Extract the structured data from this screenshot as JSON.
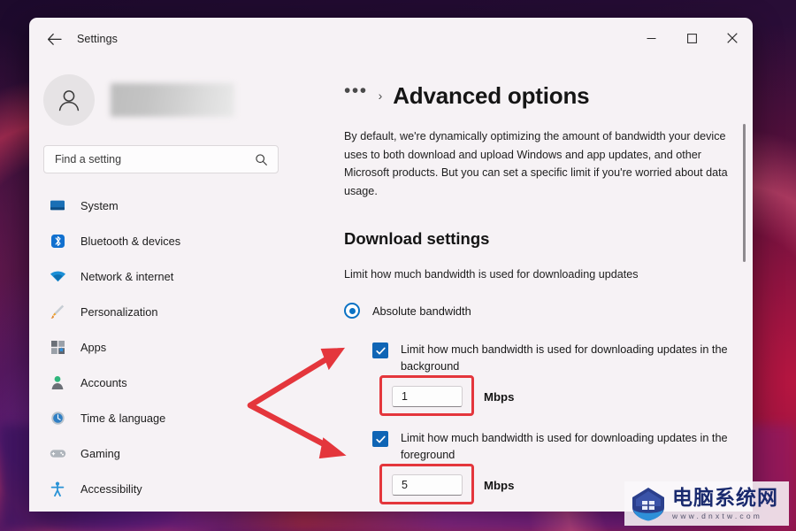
{
  "window": {
    "title": "Settings",
    "back_icon": "back-arrow-icon",
    "controls": {
      "minimize": "minimize-icon",
      "maximize": "maximize-icon",
      "close": "close-icon"
    }
  },
  "sidebar": {
    "account": {
      "name_redacted": "",
      "avatar_icon": "person-avatar-icon"
    },
    "search": {
      "placeholder": "Find a setting",
      "value": "",
      "icon": "search-icon"
    },
    "items": [
      {
        "label": "System",
        "icon": "monitor-icon"
      },
      {
        "label": "Bluetooth & devices",
        "icon": "bluetooth-icon"
      },
      {
        "label": "Network & internet",
        "icon": "wifi-icon"
      },
      {
        "label": "Personalization",
        "icon": "paintbrush-icon"
      },
      {
        "label": "Apps",
        "icon": "apps-grid-icon"
      },
      {
        "label": "Accounts",
        "icon": "person-icon"
      },
      {
        "label": "Time & language",
        "icon": "clock-icon"
      },
      {
        "label": "Gaming",
        "icon": "gamepad-icon"
      },
      {
        "label": "Accessibility",
        "icon": "accessibility-person-icon"
      }
    ]
  },
  "content": {
    "breadcrumb_overflow": "•••",
    "breadcrumb_separator": "›",
    "page_title": "Advanced options",
    "intro": "By default, we're dynamically optimizing the amount of bandwidth your device uses to both download and upload Windows and app updates, and other Microsoft products. But you can set a specific limit if you're worried about data usage.",
    "section_title": "Download settings",
    "section_subtitle": "Limit how much bandwidth is used for downloading updates",
    "radio": {
      "label": "Absolute bandwidth",
      "selected": true
    },
    "options": [
      {
        "label": "Limit how much bandwidth is used for downloading updates in the background",
        "checked": true,
        "value": "1",
        "unit": "Mbps",
        "highlighted": true
      },
      {
        "label": "Limit how much bandwidth is used for downloading updates in the foreground",
        "checked": true,
        "value": "5",
        "unit": "Mbps",
        "highlighted": true
      }
    ]
  },
  "watermark": {
    "chinese": "电脑系统网",
    "url": "www.dnxtw.com"
  },
  "colors": {
    "accent_blue": "#0f65b5",
    "radio_blue": "#0a72c4",
    "annotation_red": "#e4363c",
    "window_bg": "#f6f2f5"
  }
}
